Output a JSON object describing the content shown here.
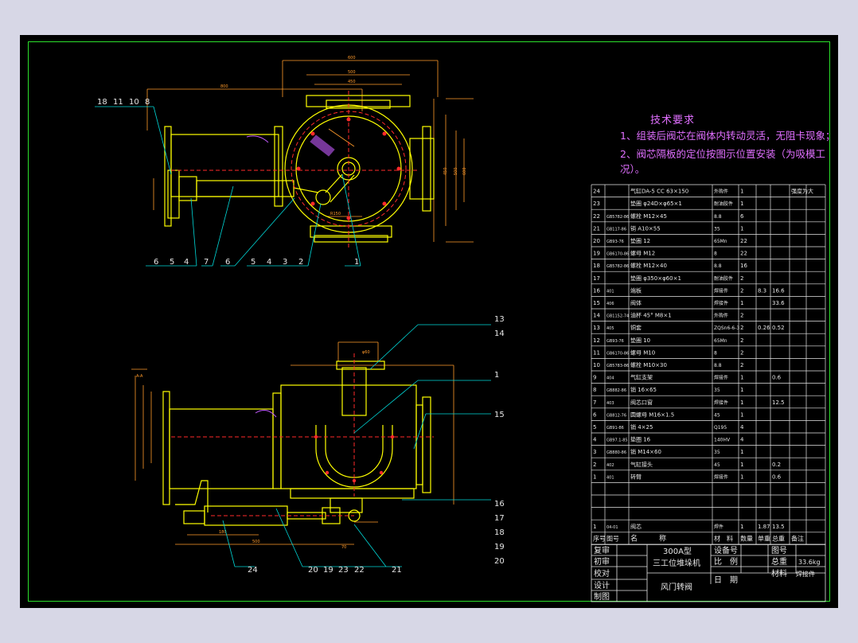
{
  "tech_req": {
    "title": "技术要求",
    "item1": "1、组装后阀芯在阀体内转动灵活，无阻卡现象；",
    "item2": "2、阀芯隔板的定位按图示位置安装（为吸模工况）。"
  },
  "top_view_balloons": [
    "18",
    "11",
    "10",
    "8",
    "6",
    "5",
    "4",
    "7",
    "6",
    "5",
    "4",
    "3",
    "2",
    "1"
  ],
  "bottom_view_balloons": [
    "13",
    "14",
    "1",
    "15",
    "16",
    "17",
    "18",
    "19",
    "20",
    "24",
    "20",
    "19",
    "23",
    "22",
    "21"
  ],
  "bom": [
    {
      "no": "24",
      "code": "",
      "name": "气缸DA-5 CC 63×150",
      "mat": "外购件",
      "qty": "1",
      "w1": "",
      "w2": "",
      "remark": "强度为大"
    },
    {
      "no": "23",
      "code": "",
      "name": "垫圈 φ24D×φ65×1",
      "mat": "耐油胶件",
      "qty": "1",
      "w1": "",
      "w2": "",
      "remark": ""
    },
    {
      "no": "22",
      "code": "GB5782-86",
      "name": "螺栓 M12×45",
      "mat": "8.8",
      "qty": "6",
      "w1": "",
      "w2": "",
      "remark": ""
    },
    {
      "no": "21",
      "code": "GB117-86",
      "name": "销 A10×55",
      "mat": "35",
      "qty": "1",
      "w1": "",
      "w2": "",
      "remark": ""
    },
    {
      "no": "20",
      "code": "GB93-76",
      "name": "垫圈 12",
      "mat": "65Mn",
      "qty": "22",
      "w1": "",
      "w2": "",
      "remark": ""
    },
    {
      "no": "19",
      "code": "GB6170-86",
      "name": "螺母 M12",
      "mat": "8",
      "qty": "22",
      "w1": "",
      "w2": "",
      "remark": ""
    },
    {
      "no": "18",
      "code": "GB5782-86",
      "name": "螺栓 M12×40",
      "mat": "8.8",
      "qty": "16",
      "w1": "",
      "w2": "",
      "remark": ""
    },
    {
      "no": "17",
      "code": "",
      "name": "垫圈 φ350×φ60×1",
      "mat": "耐油胶件",
      "qty": "2",
      "w1": "",
      "w2": "",
      "remark": ""
    },
    {
      "no": "16",
      "code": "401",
      "name": "端板",
      "mat": "焊接件",
      "qty": "2",
      "w1": "8.3",
      "w2": "16.6",
      "remark": ""
    },
    {
      "no": "15",
      "code": "406",
      "name": "阀体",
      "mat": "焊接件",
      "qty": "1",
      "w1": "",
      "w2": "33.6",
      "remark": ""
    },
    {
      "no": "14",
      "code": "GB1152-74",
      "name": "油杯 45° M8×1",
      "mat": "外购件",
      "qty": "2",
      "w1": "",
      "w2": "",
      "remark": ""
    },
    {
      "no": "13",
      "code": "405",
      "name": "铜套",
      "mat": "ZQSn6-6-3",
      "qty": "2",
      "w1": "0.26",
      "w2": "0.52",
      "remark": ""
    },
    {
      "no": "12",
      "code": "GB93-76",
      "name": "垫圈 10",
      "mat": "65Mn",
      "qty": "2",
      "w1": "",
      "w2": "",
      "remark": ""
    },
    {
      "no": "11",
      "code": "GB6170-86",
      "name": "螺母 M10",
      "mat": "8",
      "qty": "2",
      "w1": "",
      "w2": "",
      "remark": ""
    },
    {
      "no": "10",
      "code": "GB5783-86",
      "name": "螺栓 M10×30",
      "mat": "8.8",
      "qty": "2",
      "w1": "",
      "w2": "",
      "remark": ""
    },
    {
      "no": "9",
      "code": "404",
      "name": "气缸支架",
      "mat": "焊接件",
      "qty": "1",
      "w1": "",
      "w2": "0.6",
      "remark": ""
    },
    {
      "no": "8",
      "code": "GB882-86",
      "name": "销 16×65",
      "mat": "35",
      "qty": "1",
      "w1": "",
      "w2": "",
      "remark": ""
    },
    {
      "no": "7",
      "code": "403",
      "name": "阀芯口窗",
      "mat": "焊接件",
      "qty": "1",
      "w1": "",
      "w2": "12.5",
      "remark": ""
    },
    {
      "no": "6",
      "code": "GB812-76",
      "name": "圆螺母 M16×1.5",
      "mat": "45",
      "qty": "1",
      "w1": "",
      "w2": "",
      "remark": ""
    },
    {
      "no": "5",
      "code": "GB91-86",
      "name": "销 4×25",
      "mat": "Q195",
      "qty": "4",
      "w1": "",
      "w2": "",
      "remark": ""
    },
    {
      "no": "4",
      "code": "GB97.1-85",
      "name": "垫圈 16",
      "mat": "140HV",
      "qty": "4",
      "w1": "",
      "w2": "",
      "remark": ""
    },
    {
      "no": "3",
      "code": "GB880-86",
      "name": "销 M14×60",
      "mat": "35",
      "qty": "1",
      "w1": "",
      "w2": "",
      "remark": ""
    },
    {
      "no": "2",
      "code": "402",
      "name": "气缸接头",
      "mat": "45",
      "qty": "1",
      "w1": "",
      "w2": "0.2",
      "remark": ""
    },
    {
      "no": "1",
      "code": "401",
      "name": "转臂",
      "mat": "焊接件",
      "qty": "1",
      "w1": "",
      "w2": "0.6",
      "remark": ""
    },
    {
      "no": "",
      "code": "",
      "name": "",
      "mat": "",
      "qty": "",
      "w1": "",
      "w2": "",
      "remark": ""
    },
    {
      "no": "",
      "code": "",
      "name": "",
      "mat": "",
      "qty": "",
      "w1": "",
      "w2": "",
      "remark": ""
    },
    {
      "no": "",
      "code": "",
      "name": "",
      "mat": "",
      "qty": "",
      "w1": "",
      "w2": "",
      "remark": ""
    },
    {
      "no": "1",
      "code": "04-01",
      "name": "阀芯",
      "mat": "焊件",
      "qty": "1",
      "w1": "1.87",
      "w2": "13.5",
      "remark": ""
    }
  ],
  "bom_header": {
    "no": "序号",
    "code": "图号",
    "name": "名　　　称",
    "mat": "材　料",
    "qty": "数量",
    "w1": "单重",
    "w2": "总重",
    "remark": "备注"
  },
  "title_block": {
    "review1": "复审",
    "review2": "初审",
    "check": "校对",
    "design": "设计",
    "draw": "制图",
    "product_model": "300A型",
    "product_name": "三工位堆垛机",
    "drawing_name": "风门转阀",
    "equip_no_label": "设备号",
    "scale_label": "比　例",
    "date_label": "日　期",
    "dwg_no_label": "图号",
    "weight_label": "总重",
    "weight_value": "33.6kg",
    "material_label": "材料",
    "material_value": "焊接件"
  },
  "colors": {
    "border": "#2be02b",
    "outline": "#ffff00",
    "dimension": "#ff9a2a",
    "centerline": "#ff2a2a",
    "leader": "#00d8d8",
    "hatch": "#c55cff",
    "text": "#e6e6e6",
    "magenta_text": "#e06fff"
  }
}
